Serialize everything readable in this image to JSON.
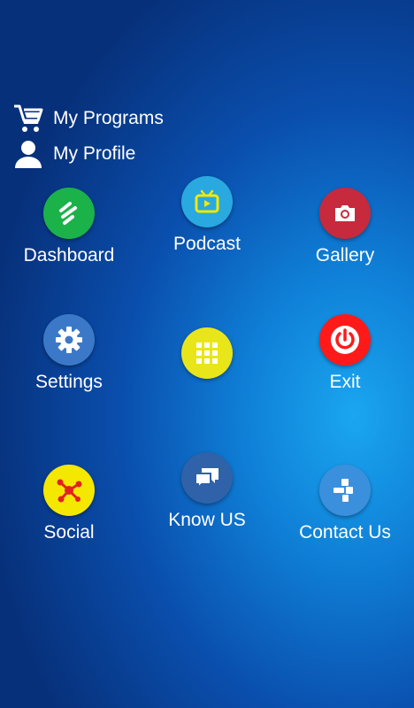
{
  "menu": {
    "programs_label": "My Programs",
    "profile_label": "My Profile"
  },
  "tiles": [
    {
      "label": "Dashboard",
      "icon": "dashboard-icon",
      "color": "#1bb24a"
    },
    {
      "label": "Podcast",
      "icon": "tv-icon",
      "color": "#29a9e0"
    },
    {
      "label": "Gallery",
      "icon": "camera-icon",
      "color": "#c62a3c"
    },
    {
      "label": "Settings",
      "icon": "gear-icon",
      "color": "#3b79c8"
    },
    {
      "label": "",
      "icon": "grid-icon",
      "color": "#e8e61a"
    },
    {
      "label": "Exit",
      "icon": "power-icon",
      "color": "#ff1a1a"
    },
    {
      "label": "Social",
      "icon": "share-icon",
      "color": "#f4e800"
    },
    {
      "label": "Know US",
      "icon": "chat-icon",
      "color": "#2f62a8"
    },
    {
      "label": "Contact Us",
      "icon": "phone-icon",
      "color": "#3a90dc"
    }
  ]
}
